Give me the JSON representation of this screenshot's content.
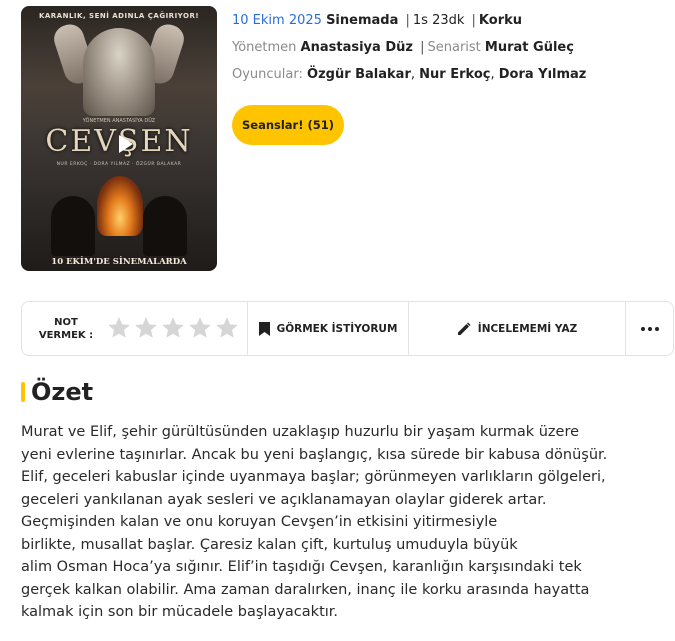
{
  "poster": {
    "banner_text": "KARANLIK, SENİ ADINLA ÇAĞIRIYOR!",
    "credit_text": "YÖNETMEN ANASTASİYA DÜZ",
    "title_text": "CEVŞEN",
    "cast_text": "NUR ERKOÇ · DORA YILMAZ · ÖZGÜR BALAKAR",
    "release_text": "10 EKİM'DE SİNEMALARDA"
  },
  "movie": {
    "release_date": "10 Ekim 2025",
    "status": "Sinemada",
    "duration": "1s 23dk",
    "genre": "Korku",
    "director_label": "Yönetmen",
    "director": "Anastasiya Düz",
    "writer_label": "Senarist",
    "writer": "Murat Güleç",
    "cast_label": "Oyuncular:",
    "cast": [
      "Özgür Balakar",
      "Nur Erkoç",
      "Dora Yılmaz"
    ],
    "separator": "|",
    "comma": ","
  },
  "sessions_button": "Seanslar! (51)",
  "actions": {
    "rate_label_line1": "NOT",
    "rate_label_line2": "VERMEK :",
    "stars": 5,
    "watchlist": "GÖRMEK İSTİYORUM",
    "review": "İNCELEMEMİ YAZ"
  },
  "summary": {
    "heading": "Özet",
    "lines": [
      "Murat ve Elif, şehir gürültüsünden uzaklaşıp huzurlu bir yaşam kurmak üzere",
      "yeni evlerine taşınırlar. Ancak bu yeni başlangıç, kısa sürede bir kabusa dönüşür.",
      "Elif, geceleri kabuslar içinde uyanmaya başlar; görünmeyen varlıkların gölgeleri,",
      "geceleri yankılanan ayak sesleri ve açıklanamayan olaylar giderek artar.",
      "Geçmişinden kalan ve onu koruyan Cevşen’in etkisini yitirmesiyle",
      "birlikte, musallat başlar. Çaresiz kalan çift, kurtuluş umuduyla büyük",
      "alim Osman Hoca’ya sığınır. Elif’in taşıdığı Cevşen, karanlığın karşısındaki tek",
      "gerçek kalkan olabilir. Ama zaman daralırken, inanç ile korku arasında hayatta",
      "kalmak için son bir mücadele başlayacaktır."
    ]
  },
  "colors": {
    "accent": "#ffc400",
    "link_blue": "#2a6fd6",
    "muted": "#8a8a8a",
    "star_empty": "#d6d6d6"
  }
}
